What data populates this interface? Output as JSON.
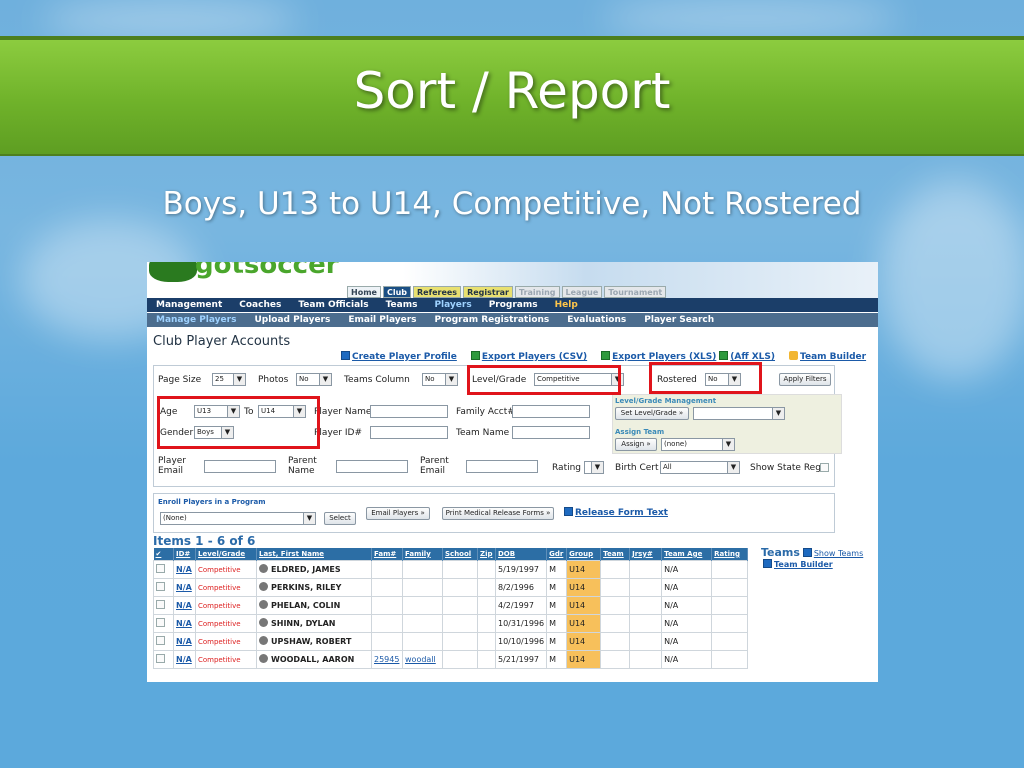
{
  "slide": {
    "title": "Sort / Report",
    "subtitle": "Boys, U13 to U14, Competitive, Not Rostered"
  },
  "topnav": {
    "items": [
      "Home",
      "Club",
      "Referees",
      "Registrar",
      "Training",
      "League",
      "Tournament"
    ]
  },
  "mainnav": {
    "items": [
      "Management",
      "Coaches",
      "Team Officials",
      "Teams",
      "Players",
      "Programs",
      "Help"
    ]
  },
  "subnav": {
    "items": [
      "Manage Players",
      "Upload Players",
      "Email Players",
      "Program Registrations",
      "Evaluations",
      "Player Search"
    ]
  },
  "page": {
    "title": "Club Player Accounts",
    "links": {
      "create_profile": "Create Player Profile",
      "export_csv": "Export Players (CSV)",
      "export_xls": "Export Players (XLS)",
      "aff_xls": "(Aff XLS)",
      "team_builder": "Team Builder"
    }
  },
  "filters": {
    "page_size_label": "Page Size",
    "page_size_value": "25",
    "photos_label": "Photos",
    "photos_value": "No",
    "teams_column_label": "Teams Column",
    "teams_column_value": "No",
    "level_grade_label": "Level/Grade",
    "level_grade_value": "Competitive",
    "rostered_label": "Rostered",
    "rostered_value": "No",
    "apply_button": "Apply Filters",
    "age_label": "Age",
    "age_from": "U13",
    "to_label": "To",
    "age_to": "U14",
    "gender_label": "Gender",
    "gender_value": "Boys",
    "player_name_label": "Player Name",
    "player_id_label": "Player ID#",
    "family_acct_label": "Family Acct#",
    "team_name_label": "Team Name",
    "player_email_label": "Player Email",
    "parent_name_label": "Parent Name",
    "parent_email_label": "Parent Email",
    "rating_label": "Rating",
    "birth_cert_label": "Birth Cert",
    "birth_cert_value": "All",
    "show_state_reg_label": "Show State Reg"
  },
  "management": {
    "level_heading": "Level/Grade Management",
    "set_level_button": "Set Level/Grade »",
    "assign_heading": "Assign Team",
    "assign_button": "Assign »",
    "assign_value": "(none)"
  },
  "enroll": {
    "heading": "Enroll Players in a Program",
    "program_value": "(None)",
    "select_button": "Select",
    "email_button": "Email Players »",
    "print_button": "Print Medical Release Forms »",
    "release_link": "Release Form Text"
  },
  "items_label": "Items 1 - 6 of 6",
  "table": {
    "headers": [
      "✔",
      "ID#",
      "Level/Grade",
      "Last, First Name",
      "Fam#",
      "Family",
      "School",
      "Zip",
      "DOB",
      "Gdr",
      "Group",
      "Team",
      "Jrsy#",
      "Team Age",
      "Rating"
    ],
    "rows": [
      {
        "id": "N/A",
        "level": "Competitive",
        "name": "ELDRED, JAMES",
        "fam": "",
        "family": "",
        "dob": "5/19/1997",
        "gdr": "M",
        "group": "U14",
        "team_age": "N/A"
      },
      {
        "id": "N/A",
        "level": "Competitive",
        "name": "PERKINS, RILEY",
        "fam": "",
        "family": "",
        "dob": "8/2/1996",
        "gdr": "M",
        "group": "U14",
        "team_age": "N/A"
      },
      {
        "id": "N/A",
        "level": "Competitive",
        "name": "PHELAN, COLIN",
        "fam": "",
        "family": "",
        "dob": "4/2/1997",
        "gdr": "M",
        "group": "U14",
        "team_age": "N/A"
      },
      {
        "id": "N/A",
        "level": "Competitive",
        "name": "SHINN, DYLAN",
        "fam": "",
        "family": "",
        "dob": "10/31/1996",
        "gdr": "M",
        "group": "U14",
        "team_age": "N/A"
      },
      {
        "id": "N/A",
        "level": "Competitive",
        "name": "UPSHAW, ROBERT",
        "fam": "",
        "family": "",
        "dob": "10/10/1996",
        "gdr": "M",
        "group": "U14",
        "team_age": "N/A"
      },
      {
        "id": "N/A",
        "level": "Competitive",
        "name": "WOODALL, AARON",
        "fam": "25945",
        "family": "woodall",
        "dob": "5/21/1997",
        "gdr": "M",
        "group": "U14",
        "team_age": "N/A"
      }
    ]
  },
  "teams_panel": {
    "title": "Teams",
    "show_link": "Show Teams",
    "builder_link": "Team Builder"
  }
}
